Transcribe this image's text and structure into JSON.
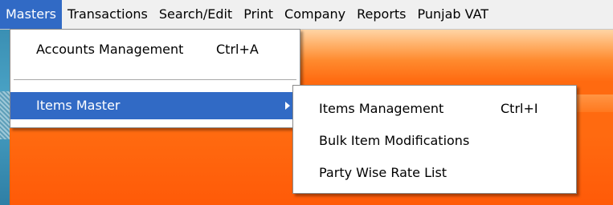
{
  "menubar": {
    "items": [
      "Masters",
      "Transactions",
      "Search/Edit",
      "Print",
      "Company",
      "Reports",
      "Punjab VAT"
    ]
  },
  "masters_menu": {
    "accounts_management": {
      "label": "Accounts Management",
      "shortcut": "Ctrl+A"
    },
    "items_master": {
      "label": "Items Master"
    }
  },
  "items_submenu": {
    "items_management": {
      "label": "Items Management",
      "shortcut": "Ctrl+I"
    },
    "bulk_item_modifications": {
      "label": "Bulk Item Modifications"
    },
    "party_wise_rate_list": {
      "label": "Party Wise Rate List"
    }
  },
  "colors": {
    "highlight": "#316ac5",
    "background": "#ff6a10"
  }
}
